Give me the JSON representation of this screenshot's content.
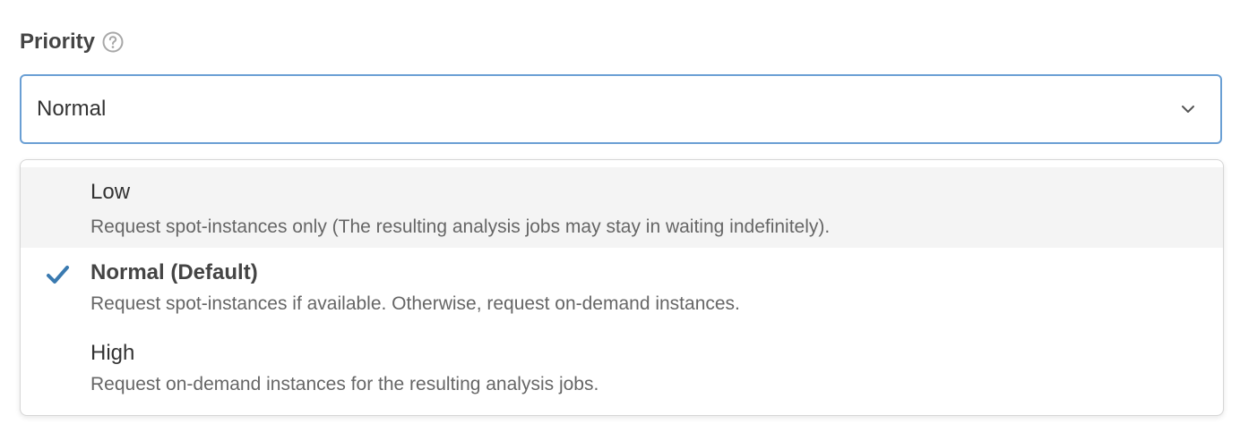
{
  "field": {
    "label": "Priority",
    "help_icon": "question-circle-icon"
  },
  "select": {
    "value": "Normal",
    "chevron_icon": "chevron-down-icon",
    "border_color": "#6a9fd4"
  },
  "options": [
    {
      "title": "Low",
      "description": "Request spot-instances only (The resulting analysis jobs may stay in waiting indefinitely).",
      "selected": false,
      "hovered": true
    },
    {
      "title": "Normal (Default)",
      "description": "Request spot-instances if available. Otherwise, request on-demand instances.",
      "selected": true,
      "hovered": false,
      "check_icon": "checkmark-icon",
      "check_color": "#3a7ab0"
    },
    {
      "title": "High",
      "description": "Request on-demand instances for the resulting analysis jobs.",
      "selected": false,
      "hovered": false
    }
  ]
}
